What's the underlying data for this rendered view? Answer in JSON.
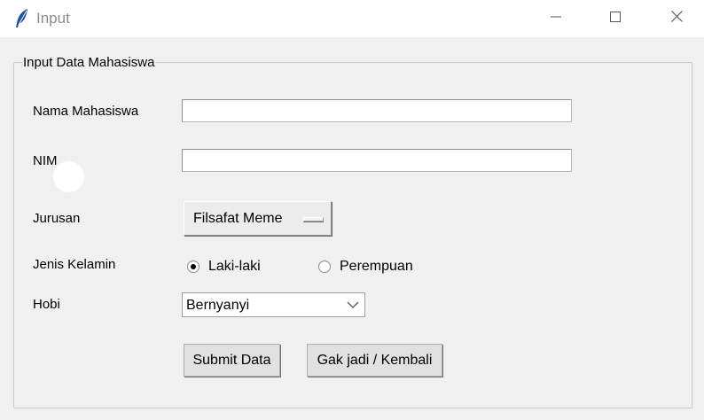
{
  "window": {
    "title": "Input",
    "icon": "feather-icon",
    "controls": [
      "minimize-icon",
      "maximize-icon",
      "close-icon"
    ]
  },
  "form": {
    "group_title": "Input Data Mahasiswa",
    "labels": {
      "nama": "Nama Mahasiswa",
      "nim": "NIM",
      "jurusan": "Jurusan",
      "jenis_kelamin": "Jenis Kelamin",
      "hobi": "Hobi"
    },
    "nama_value": "",
    "nim_value": "",
    "jurusan_selected": "Filsafat Meme",
    "gender_options": [
      {
        "label": "Laki-laki",
        "selected": true
      },
      {
        "label": "Perempuan",
        "selected": false
      }
    ],
    "hobi_selected": "Bernyanyi",
    "buttons": {
      "submit": "Submit Data",
      "back": "Gak jadi / Kembali"
    }
  }
}
